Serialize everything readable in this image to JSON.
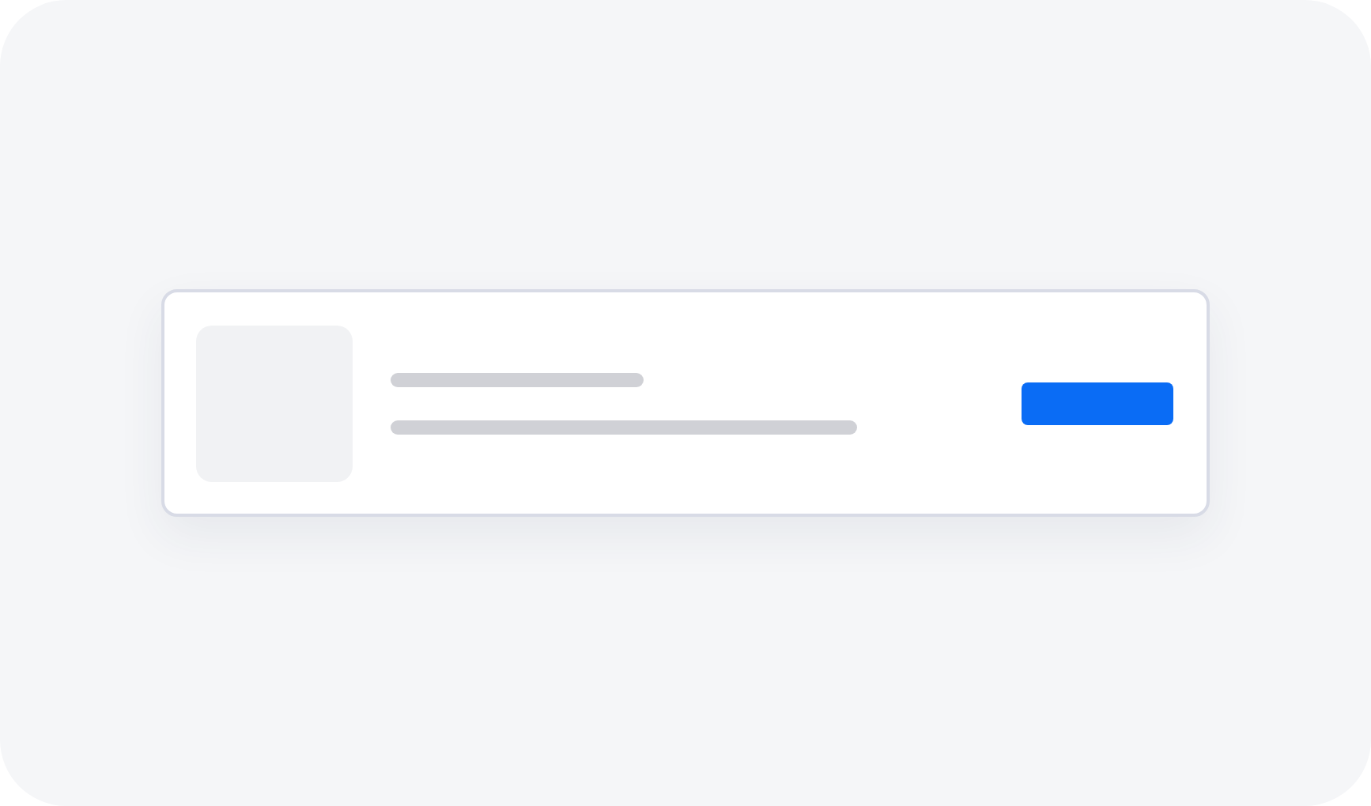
{
  "placeholder_card": {
    "kind": "skeleton",
    "thumbnail": {
      "kind": "placeholder"
    },
    "lines": [
      {
        "kind": "short"
      },
      {
        "kind": "long"
      }
    ],
    "button": {
      "kind": "primary"
    }
  }
}
